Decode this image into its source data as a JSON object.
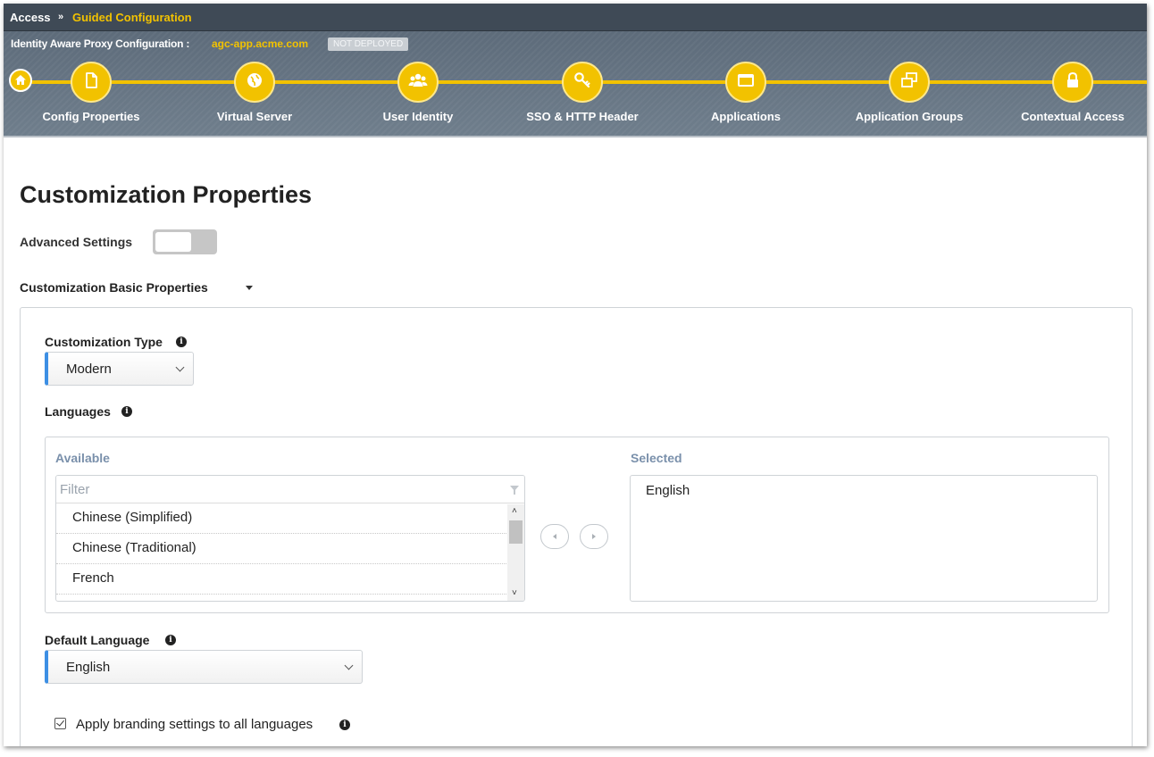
{
  "breadcrumb": {
    "root": "Access",
    "separator": "»",
    "current": "Guided Configuration"
  },
  "config": {
    "label": "Identity Aware Proxy Configuration :",
    "name": "agc-app.acme.com",
    "status": "NOT DEPLOYED"
  },
  "wizard": {
    "steps": [
      {
        "label": "Config Properties",
        "icon": "document-icon"
      },
      {
        "label": "Virtual Server",
        "icon": "globe-icon"
      },
      {
        "label": "User Identity",
        "icon": "users-icon"
      },
      {
        "label": "SSO & HTTP Header",
        "icon": "key-icon"
      },
      {
        "label": "Applications",
        "icon": "window-icon"
      },
      {
        "label": "Application Groups",
        "icon": "windows-stack-icon"
      },
      {
        "label": "Contextual Access",
        "icon": "lock-icon"
      }
    ]
  },
  "page": {
    "title": "Customization Properties",
    "advanced_settings_label": "Advanced Settings",
    "advanced_settings_on": false,
    "section_title": "Customization Basic Properties"
  },
  "customization_type": {
    "label": "Customization Type",
    "value": "Modern"
  },
  "languages": {
    "label": "Languages",
    "available_header": "Available",
    "selected_header": "Selected",
    "filter_placeholder": "Filter",
    "available": [
      "Chinese (Simplified)",
      "Chinese (Traditional)",
      "French"
    ],
    "selected": [
      "English"
    ]
  },
  "default_language": {
    "label": "Default Language",
    "value": "English"
  },
  "branding": {
    "label": "Apply branding settings to all languages",
    "checked": true
  },
  "colors": {
    "accent": "#f2c200",
    "header_bg": "#3f4a56",
    "select_accent": "#3d8fe4"
  }
}
